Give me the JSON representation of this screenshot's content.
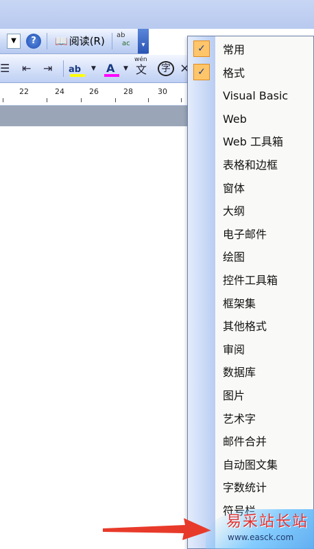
{
  "toolbar_standard": {
    "read_label": "阅读(R)",
    "help_glyph": "?",
    "dropdown_glyph": "▼",
    "spell_glyph_top": "ab",
    "spell_glyph_bottom": "ac",
    "overflow_glyph": "▾"
  },
  "toolbar_format": {
    "list_glyph": "☰",
    "decrease_indent_glyph": "⇤",
    "increase_indent_glyph": "⇥",
    "highlight_glyph": "ab",
    "font_color_glyph": "A",
    "phonetic_glyph": "wén",
    "phonetic_char": "文",
    "enclose_char": "字",
    "close_glyph": "×"
  },
  "ruler": {
    "numbers": [
      "22",
      "24",
      "26",
      "28",
      "30"
    ]
  },
  "toolbar_menu": {
    "items": [
      {
        "label": "常用",
        "checked": true
      },
      {
        "label": "格式",
        "checked": true
      },
      {
        "label": "Visual Basic",
        "checked": false
      },
      {
        "label": "Web",
        "checked": false
      },
      {
        "label": "Web 工具箱",
        "checked": false
      },
      {
        "label": "表格和边框",
        "checked": false
      },
      {
        "label": "窗体",
        "checked": false
      },
      {
        "label": "大纲",
        "checked": false
      },
      {
        "label": "电子邮件",
        "checked": false
      },
      {
        "label": "绘图",
        "checked": false
      },
      {
        "label": "控件工具箱",
        "checked": false
      },
      {
        "label": "框架集",
        "checked": false
      },
      {
        "label": "其他格式",
        "checked": false
      },
      {
        "label": "审阅",
        "checked": false
      },
      {
        "label": "数据库",
        "checked": false
      },
      {
        "label": "图片",
        "checked": false
      },
      {
        "label": "艺术字",
        "checked": false
      },
      {
        "label": "邮件合并",
        "checked": false
      },
      {
        "label": "自动图文集",
        "checked": false
      },
      {
        "label": "字数统计",
        "checked": false
      },
      {
        "label": "符号栏",
        "checked": false
      }
    ],
    "check_glyph": "✓"
  },
  "watermark": {
    "site_name": "易采站长站",
    "url": "www.easck.com"
  },
  "colors": {
    "highlight": "#ffff00",
    "font_color": "#ff00ff",
    "check_bg": "#ffc56b",
    "arrow": "#e83a2a"
  }
}
